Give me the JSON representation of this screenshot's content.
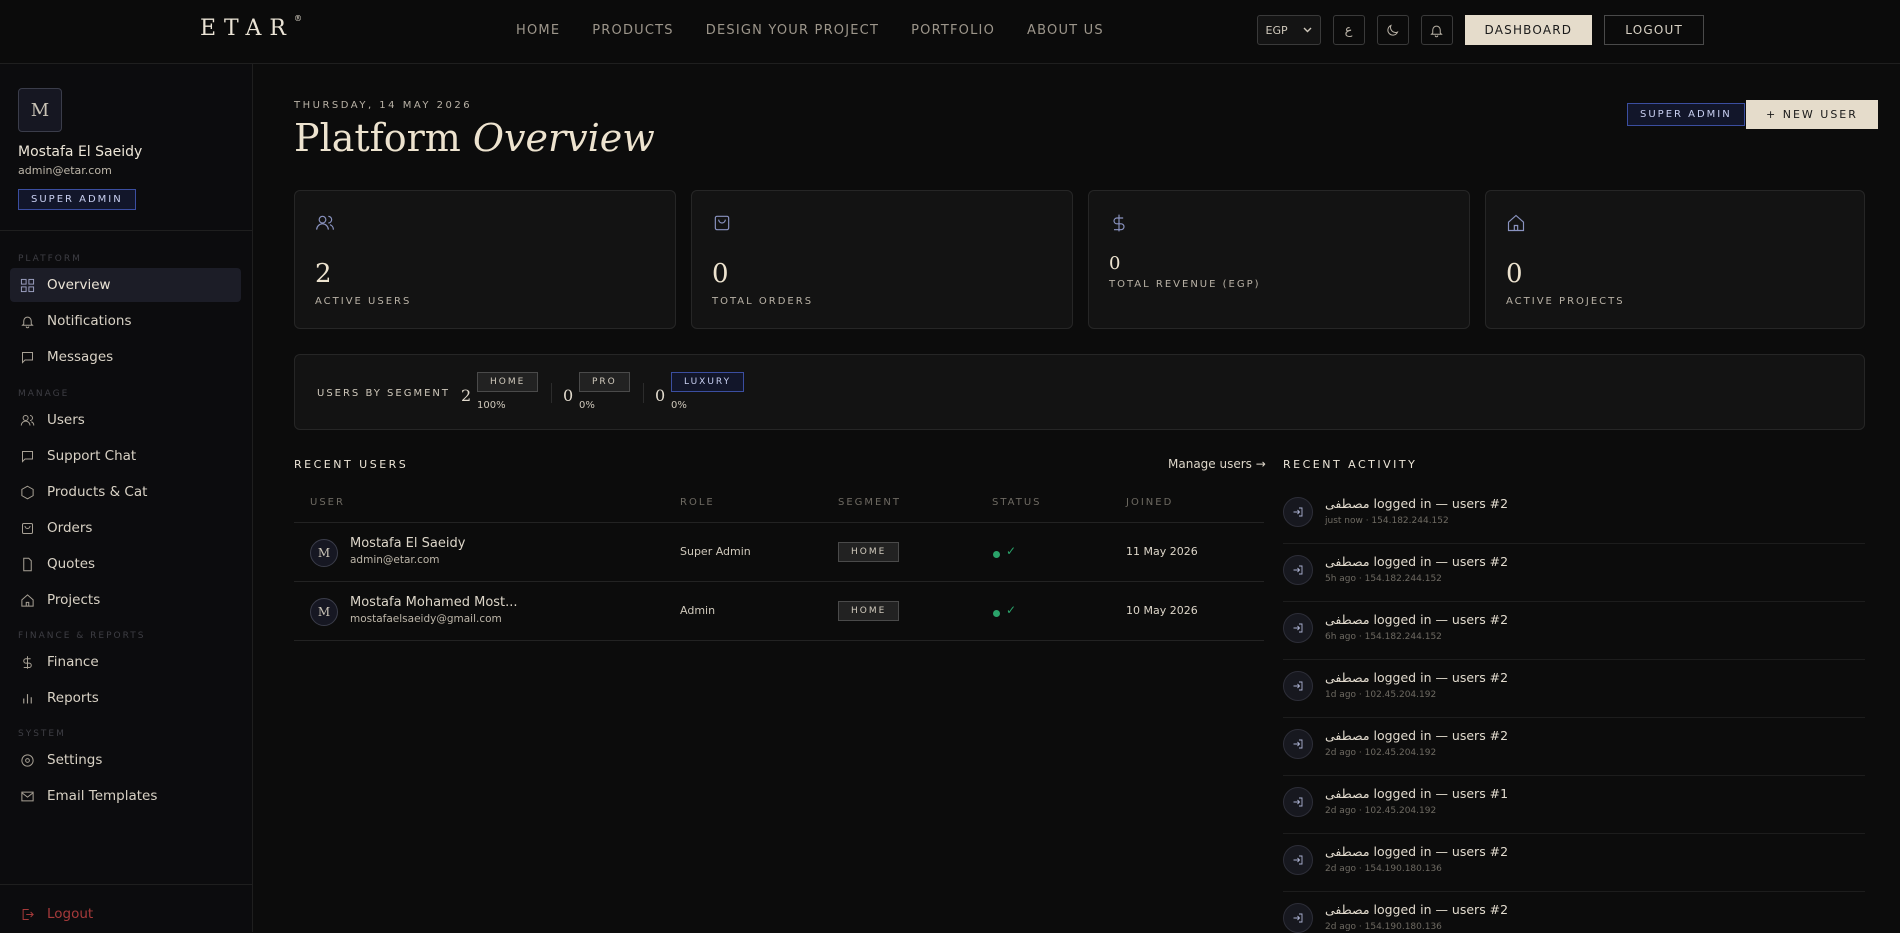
{
  "nav": {
    "logo": "ETAR",
    "logo_mark": "®",
    "links": [
      "HOME",
      "PRODUCTS",
      "DESIGN YOUR PROJECT",
      "PORTFOLIO",
      "ABOUT US"
    ],
    "currency": "EGP",
    "lang": "ع",
    "dashboard_label": "DASHBOARD",
    "logout_label": "LOGOUT"
  },
  "sidebar": {
    "avatar_initial": "M",
    "user_name": "Mostafa El Saeidy",
    "user_email": "admin@etar.com",
    "role_badge": "SUPER ADMIN",
    "sections": {
      "platform": "PLATFORM",
      "manage": "MANAGE",
      "finance": "FINANCE & REPORTS",
      "system": "SYSTEM"
    },
    "items": {
      "overview": "Overview",
      "notifications": "Notifications",
      "messages": "Messages",
      "users": "Users",
      "support": "Support Chat",
      "products": "Products & Cat",
      "orders": "Orders",
      "quotes": "Quotes",
      "projects": "Projects",
      "finance": "Finance",
      "reports": "Reports",
      "settings": "Settings",
      "email": "Email Templates"
    },
    "logout": "Logout"
  },
  "main": {
    "date": "THURSDAY, 14 MAY 2026",
    "title_plain": "Platform",
    "title_italic": "Overview",
    "role_badge": "SUPER ADMIN",
    "new_user": "+ NEW USER",
    "stats": [
      {
        "value": "2",
        "label": "ACTIVE USERS",
        "icon": "users-icon"
      },
      {
        "value": "0",
        "label": "TOTAL ORDERS",
        "icon": "bag-icon"
      },
      {
        "value": "0",
        "label": "TOTAL REVENUE (EGP)",
        "icon": "dollar-icon"
      },
      {
        "value": "0",
        "label": "ACTIVE PROJECTS",
        "icon": "home-icon"
      }
    ],
    "segments": {
      "label": "USERS BY SEGMENT",
      "items": [
        {
          "count": "2",
          "name": "HOME",
          "pct": "100%"
        },
        {
          "count": "0",
          "name": "PRO",
          "pct": "0%"
        },
        {
          "count": "0",
          "name": "LUXURY",
          "pct": "0%"
        }
      ]
    },
    "recent_users": {
      "title": "RECENT USERS",
      "manage": "Manage users →",
      "columns": [
        "USER",
        "ROLE",
        "SEGMENT",
        "STATUS",
        "JOINED"
      ],
      "rows": [
        {
          "initial": "M",
          "name": "Mostafa El Saeidy",
          "email": "admin@etar.com",
          "role": "Super Admin",
          "segment": "HOME",
          "status": "✓",
          "joined": "11 May 2026"
        },
        {
          "initial": "M",
          "name": "Mostafa Mohamed Most...",
          "email": "mostafaelsaeidy@gmail.com",
          "role": "Admin",
          "segment": "HOME",
          "status": "✓",
          "joined": "10 May 2026"
        }
      ]
    },
    "activity": {
      "title": "RECENT ACTIVITY",
      "items": [
        {
          "text": "مصطفى logged in — users #2",
          "meta": "just now · 154.182.244.152"
        },
        {
          "text": "مصطفى logged in — users #2",
          "meta": "5h ago · 154.182.244.152"
        },
        {
          "text": "مصطفى logged in — users #2",
          "meta": "6h ago · 154.182.244.152"
        },
        {
          "text": "مصطفى logged in — users #2",
          "meta": "1d ago · 102.45.204.192"
        },
        {
          "text": "مصطفى logged in — users #2",
          "meta": "2d ago · 102.45.204.192"
        },
        {
          "text": "مصطفى logged in — users #1",
          "meta": "2d ago · 102.45.204.192"
        },
        {
          "text": "مصطفى logged in — users #2",
          "meta": "2d ago · 154.190.180.136"
        },
        {
          "text": "مصطفى logged in — users #2",
          "meta": "2d ago · 154.190.180.136"
        }
      ]
    }
  },
  "colors": {
    "accent": "#e5dccb",
    "badge_blue": "#3b4ea0",
    "status_green": "#2aa36a",
    "logout_red": "#a63a3a"
  }
}
